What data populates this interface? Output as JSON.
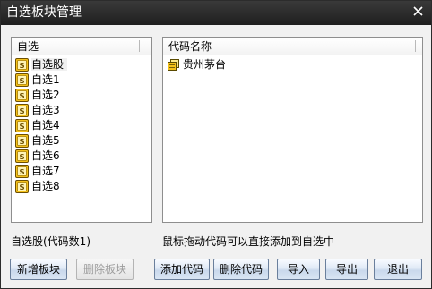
{
  "window": {
    "title": "自选板块管理"
  },
  "left_panel": {
    "header": "自选",
    "items": [
      {
        "label": "自选股",
        "icon": "dollar-icon"
      },
      {
        "label": "自选1",
        "icon": "dollar-icon"
      },
      {
        "label": "自选2",
        "icon": "dollar-icon"
      },
      {
        "label": "自选3",
        "icon": "dollar-icon"
      },
      {
        "label": "自选4",
        "icon": "dollar-icon"
      },
      {
        "label": "自选5",
        "icon": "dollar-icon"
      },
      {
        "label": "自选6",
        "icon": "dollar-icon"
      },
      {
        "label": "自选7",
        "icon": "dollar-icon"
      },
      {
        "label": "自选8",
        "icon": "dollar-icon"
      }
    ],
    "status": "自选股(代码数1)"
  },
  "right_panel": {
    "header": "代码名称",
    "items": [
      {
        "label": "贵州茅台",
        "icon": "stock-icon"
      }
    ],
    "hint": "鼠标拖动代码可以直接添加到自选中"
  },
  "buttons": {
    "new_block": "新增板块",
    "delete_block": "删除板块",
    "add_code": "添加代码",
    "delete_code": "删除代码",
    "import": "导入",
    "export": "导出",
    "exit": "退出"
  },
  "colors": {
    "titlebar": "#262626",
    "dollar_icon": "#d9a600",
    "panel_border": "#8e8e8e"
  }
}
